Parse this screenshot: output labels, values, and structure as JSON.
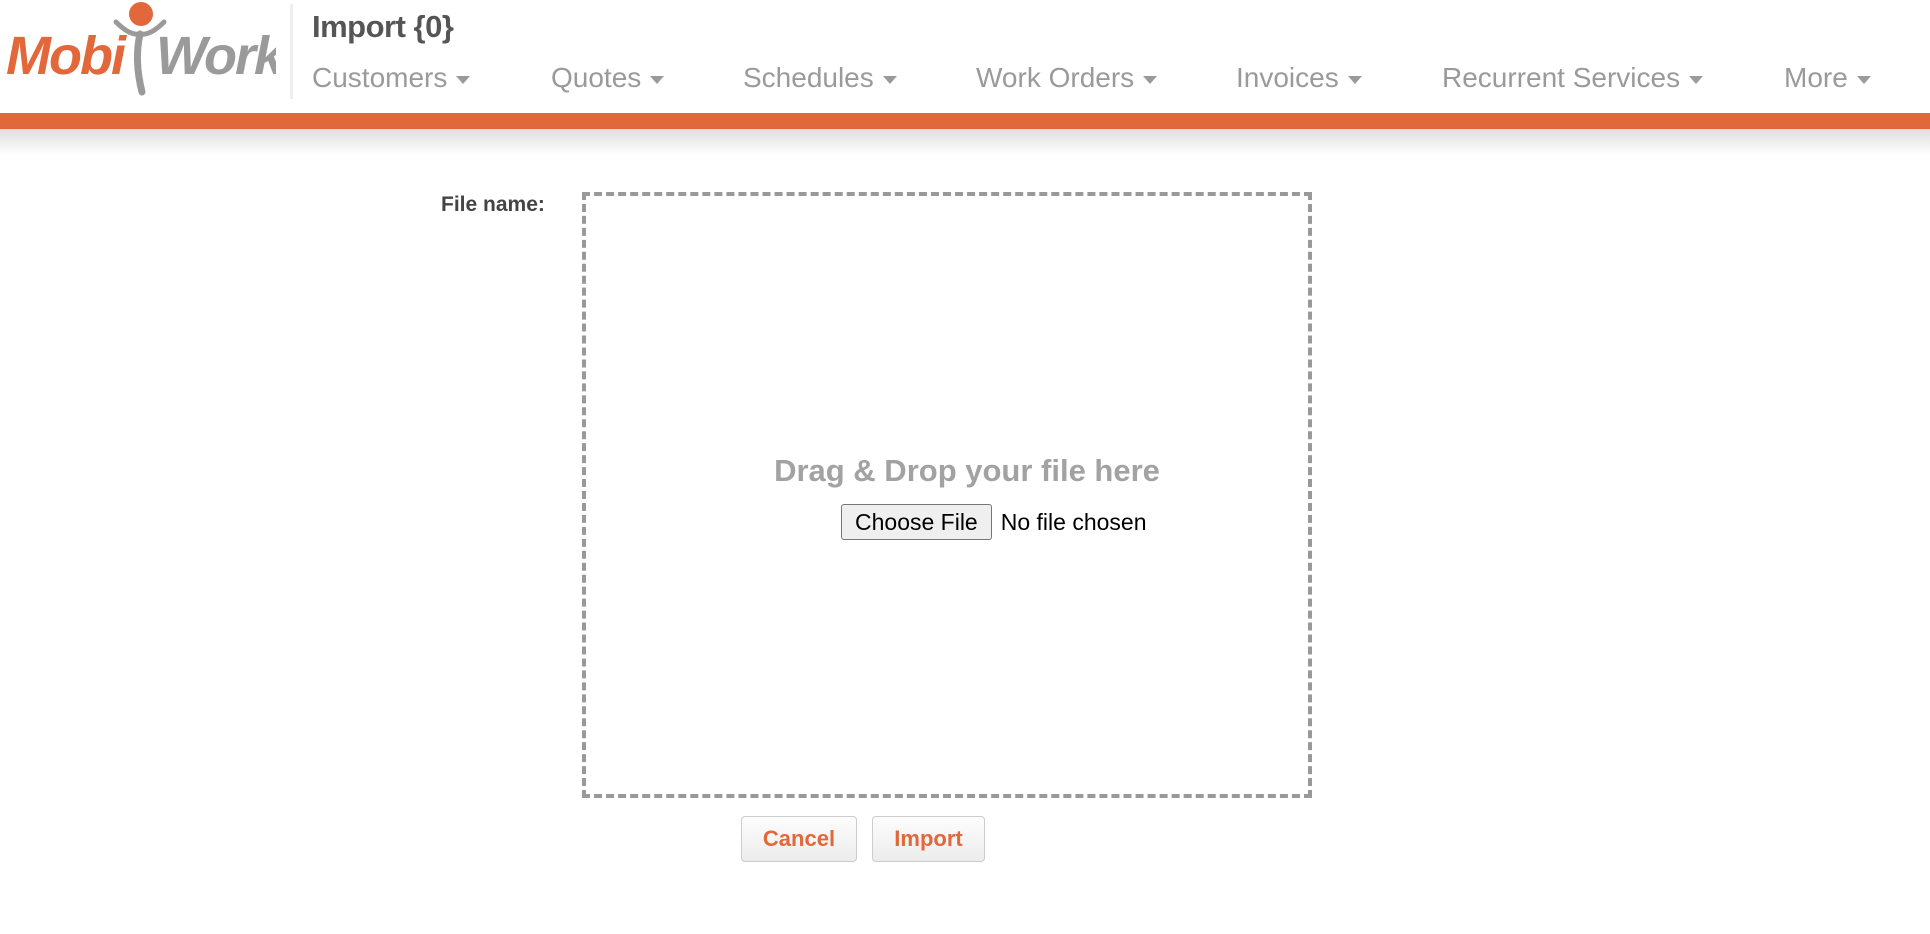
{
  "app": {
    "logo_text": [
      "Mobi",
      "Work"
    ],
    "page_title": "Import {0}"
  },
  "nav": {
    "items": [
      {
        "label": "Customers",
        "icon": "caret-down-icon"
      },
      {
        "label": "Quotes",
        "icon": "caret-down-icon"
      },
      {
        "label": "Schedules",
        "icon": "caret-down-icon"
      },
      {
        "label": "Work Orders",
        "icon": "caret-down-icon"
      },
      {
        "label": "Invoices",
        "icon": "caret-down-icon"
      },
      {
        "label": "Recurrent Services",
        "icon": "caret-down-icon"
      },
      {
        "label": "More",
        "icon": "caret-down-icon"
      }
    ]
  },
  "form": {
    "file_label": "File name:",
    "dropzone_text": "Drag & Drop your file here",
    "choose_button": "Choose File",
    "file_status": "No file chosen"
  },
  "actions": {
    "cancel_label": "Cancel",
    "import_label": "Import"
  },
  "colors": {
    "accent": "#e2673a",
    "nav_text": "#9a9a9a",
    "title_text": "#555555",
    "dropzone_border": "#999999"
  }
}
